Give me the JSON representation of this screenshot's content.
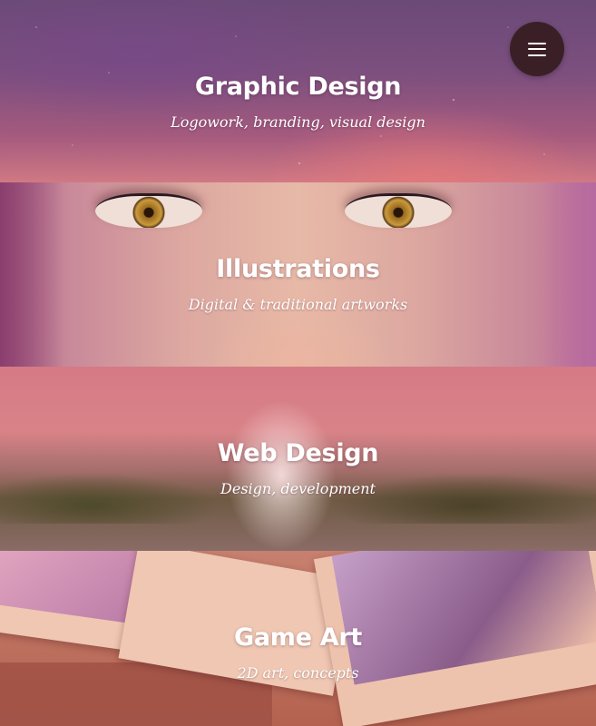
{
  "nav": {
    "menu_icon": "hamburger-menu-icon"
  },
  "panels": [
    {
      "title": "Graphic Design",
      "subtitle": "Logowork, branding, visual design"
    },
    {
      "title": "Illustrations",
      "subtitle": "Digital & traditional artworks"
    },
    {
      "title": "Web Design",
      "subtitle": "Design, development"
    },
    {
      "title": "Game Art",
      "subtitle": "2D art, concepts"
    }
  ],
  "colors": {
    "menu_button_bg": "#3a2026",
    "heading_text": "#ffffff",
    "panel_tint": "#d57a86"
  }
}
